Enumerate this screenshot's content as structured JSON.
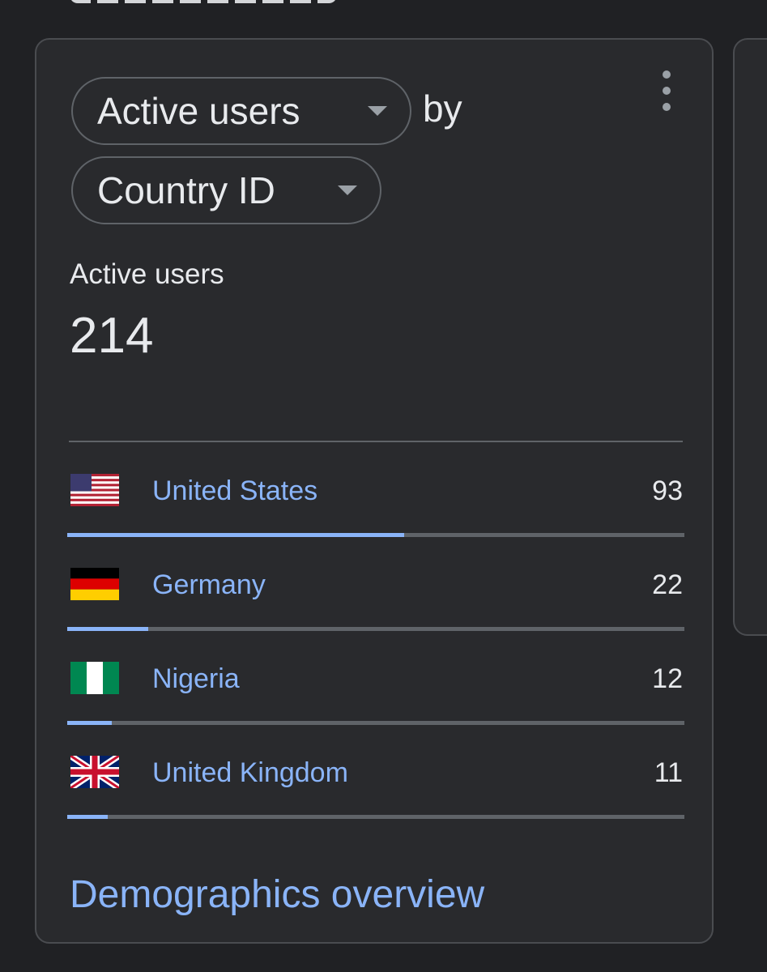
{
  "card": {
    "metric_chip": "Active users",
    "by_word": "by",
    "dimension_chip": "Country ID",
    "metric_label": "Active users",
    "metric_value": "214",
    "rows": [
      {
        "country": "United States",
        "value": "93",
        "share": 0.5453,
        "flag": "us-flag-icon"
      },
      {
        "country": "Germany",
        "value": "22",
        "share": 0.1318,
        "flag": "germany-flag-icon"
      },
      {
        "country": "Nigeria",
        "value": "12",
        "share": 0.0725,
        "flag": "nigeria-flag-icon"
      },
      {
        "country": "United Kingdom",
        "value": "11",
        "share": 0.0659,
        "flag": "uk-flag-icon"
      }
    ],
    "footer_link": "Demographics overview"
  },
  "colors": {
    "background": "#202124",
    "card": "#292a2d",
    "accent": "#8ab4f8",
    "track": "#5f6368",
    "text": "#e8eaed"
  },
  "icons": {
    "caret": "chevron-down-icon",
    "menu": "more-vert-icon"
  }
}
